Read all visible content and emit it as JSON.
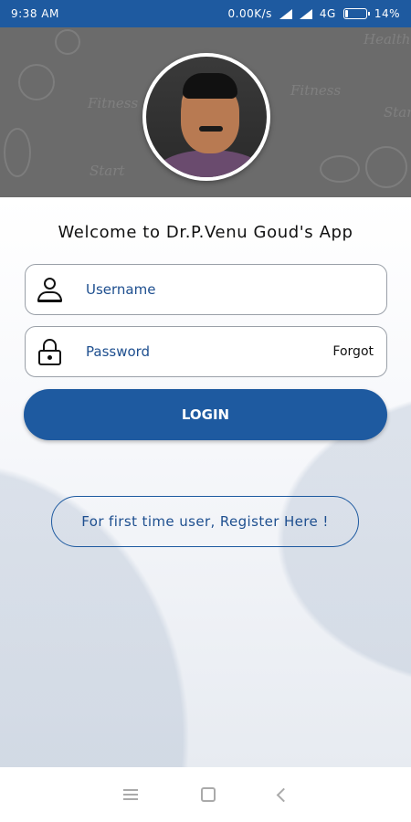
{
  "status_bar": {
    "time": "9:38 AM",
    "network_speed": "0.00K/s",
    "network_type": "4G",
    "battery_level": "14%",
    "battery_fill_fraction": 0.14
  },
  "header": {
    "doodles": [
      "Fitness",
      "Start",
      "Health",
      "Start",
      "Fitness"
    ]
  },
  "welcome": {
    "title": "Welcome to Dr.P.Venu Goud's App"
  },
  "login_form": {
    "username_placeholder": "Username",
    "password_placeholder": "Password",
    "forgot_label": "Forgot",
    "login_label": "LOGIN"
  },
  "register": {
    "label": "For first time user, Register Here !"
  },
  "colors": {
    "primary": "#1e5aa0",
    "header_gray": "#6b6b6b"
  },
  "icons": {
    "username": "user-icon",
    "password": "lock-icon",
    "nav_menu": "menu-icon",
    "nav_home": "home-icon",
    "nav_back": "back-icon"
  }
}
